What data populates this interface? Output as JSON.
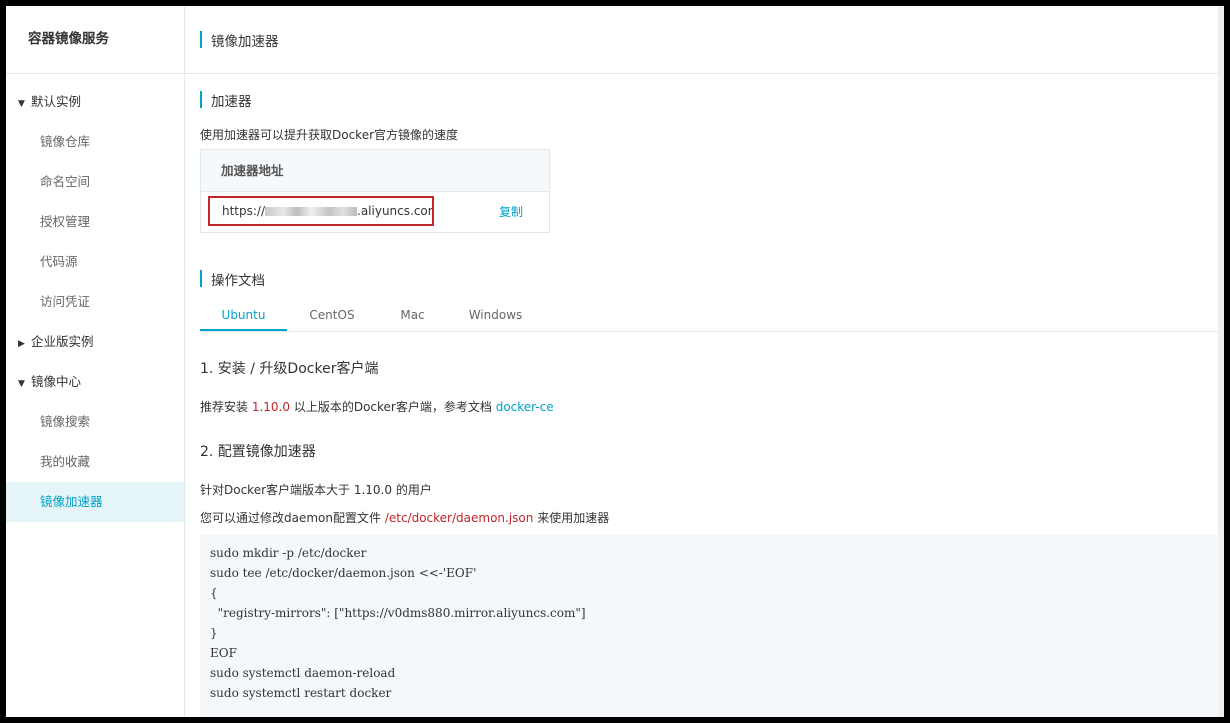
{
  "sidebar": {
    "title": "容器镜像服务",
    "groups": [
      {
        "label": "默认实例",
        "arrow": "▼",
        "items": [
          "镜像仓库",
          "命名空间",
          "授权管理",
          "代码源",
          "访问凭证"
        ]
      },
      {
        "label": "企业版实例",
        "arrow": "▶",
        "items": []
      },
      {
        "label": "镜像中心",
        "arrow": "▼",
        "items": [
          "镜像搜索",
          "我的收藏",
          "镜像加速器"
        ]
      }
    ],
    "active_item": "镜像加速器"
  },
  "header": {
    "title": "镜像加速器"
  },
  "accelerator": {
    "section_title": "加速器",
    "description": "使用加速器可以提升获取Docker官方镜像的速度",
    "table_header": "加速器地址",
    "url_prefix": "https://",
    "url_suffix": ".aliyuncs.com",
    "copy_label": "复制"
  },
  "docs": {
    "section_title": "操作文档",
    "tabs": [
      "Ubuntu",
      "CentOS",
      "Mac",
      "Windows"
    ],
    "active_tab": "Ubuntu",
    "step1": {
      "title": "1. 安装 / 升级Docker客户端",
      "text_a": "推荐安装",
      "version": "1.10.0",
      "text_b": "以上版本的Docker客户端，参考文档",
      "link": "docker-ce"
    },
    "step2": {
      "title": "2. 配置镜像加速器",
      "line1": "针对Docker客户端版本大于 1.10.0 的用户",
      "line2_a": "您可以通过修改daemon配置文件",
      "line2_path": "/etc/docker/daemon.json",
      "line2_b": "来使用加速器"
    },
    "code_lines": [
      "sudo mkdir -p /etc/docker",
      "sudo tee /etc/docker/daemon.json <<-'EOF'",
      "{",
      "  \"registry-mirrors\": [\"https://v0dms880.mirror.aliyuncs.com\"]",
      "}",
      "EOF",
      "sudo systemctl daemon-reload",
      "sudo systemctl restart docker"
    ]
  },
  "colors": {
    "accent": "#00a2ca",
    "highlight_red": "#c0252b",
    "active_bg": "#e6f5f7"
  }
}
